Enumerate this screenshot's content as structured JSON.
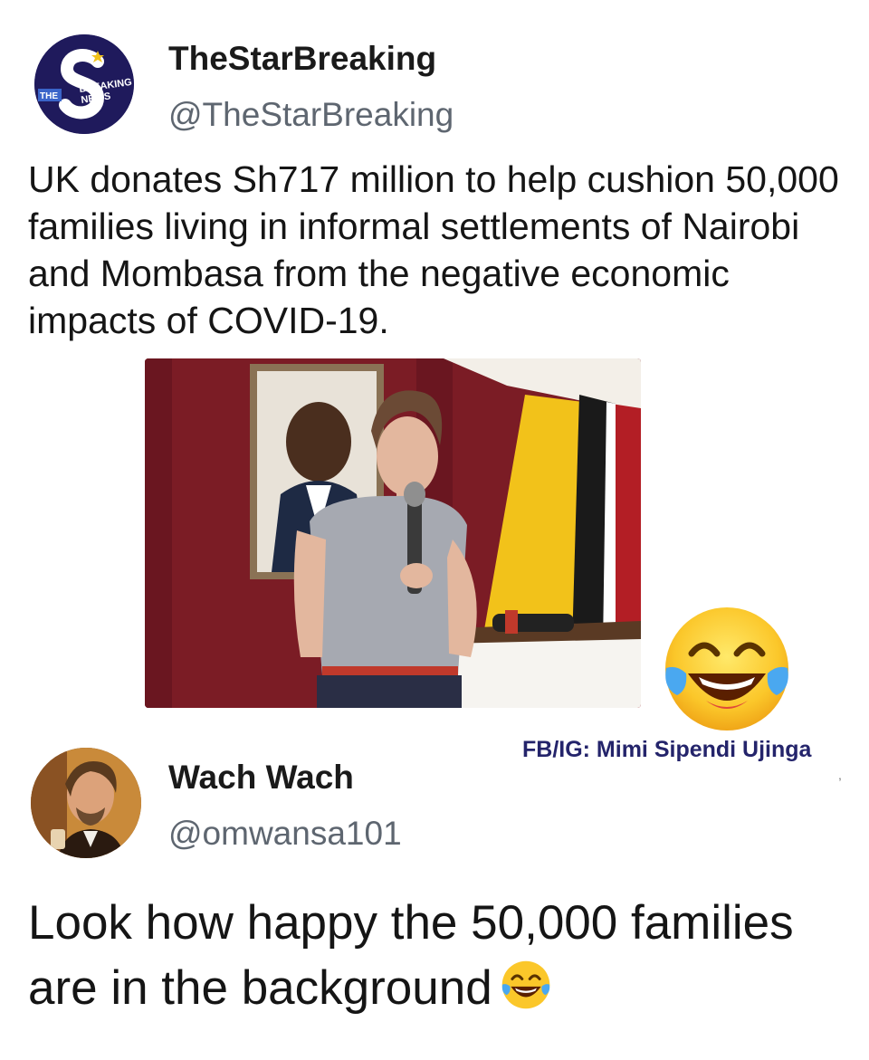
{
  "tweet": {
    "author_name": "TheStarBreaking",
    "author_handle": "@TheStarBreaking",
    "avatar_text": {
      "brand": "THE",
      "line1": "BREAKING",
      "line2": "NEWS"
    },
    "text": "UK donates Sh717 million to help cushion 50,000 families living in informal settlements of Nairobi and Mombasa from the negative economic impacts of COVID-19."
  },
  "watermark": "FB/IG: Mimi Sipendi Ujinga",
  "reply": {
    "author_name": "Wach Wach",
    "author_handle": "@omwansa101",
    "text": "Look how happy the 50,000 families are in the background",
    "emoji": "face-with-tears-of-joy-icon"
  },
  "colors": {
    "handle_gray": "#5e6670",
    "text_dark": "#151515",
    "watermark_navy": "#24246b",
    "avatar_navy": "#1f1a5c",
    "curtain_maroon": "#7b1c25",
    "flag_yellow": "#f2c21a"
  }
}
